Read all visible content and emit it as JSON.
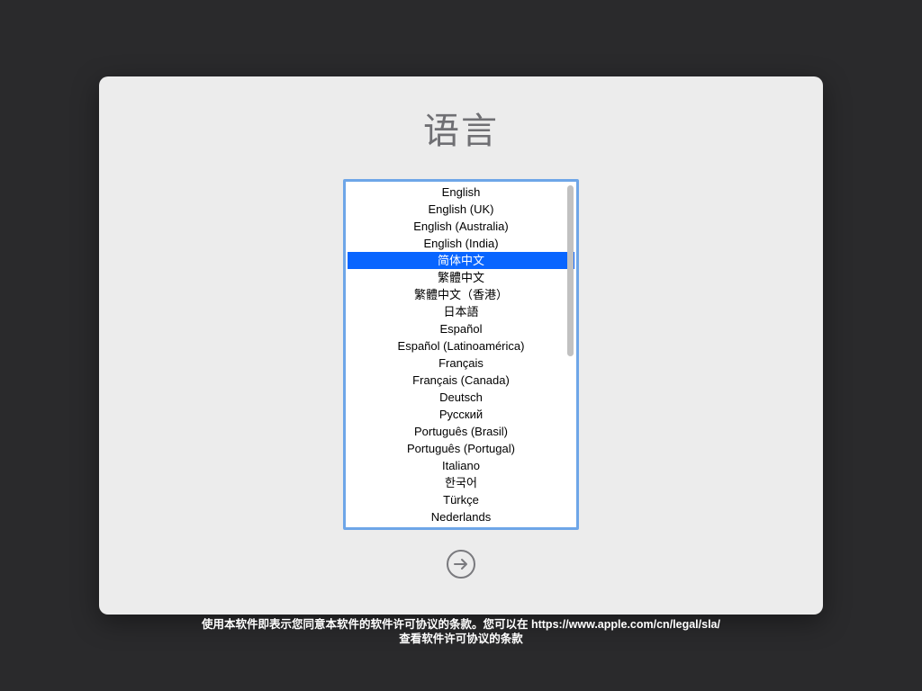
{
  "title": "语言",
  "selected_index": 4,
  "languages": [
    "English",
    "English (UK)",
    "English (Australia)",
    "English (India)",
    "简体中文",
    "繁體中文",
    "繁體中文（香港）",
    "日本語",
    "Español",
    "Español (Latinoamérica)",
    "Français",
    "Français (Canada)",
    "Deutsch",
    "Русский",
    "Português (Brasil)",
    "Português (Portugal)",
    "Italiano",
    "한국어",
    "Türkçe",
    "Nederlands"
  ],
  "footer": {
    "line1": "使用本软件即表示您同意本软件的软件许可协议的条款。您可以在 https://www.apple.com/cn/legal/sla/",
    "line2": "查看软件许可协议的条款"
  }
}
